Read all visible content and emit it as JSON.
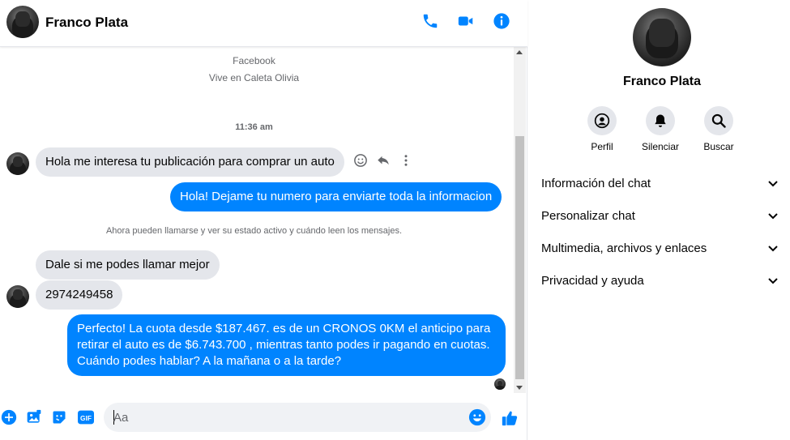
{
  "contact": {
    "name": "Franco Plata"
  },
  "chat": {
    "meta": {
      "source": "Facebook",
      "location": "Vive en Caleta Olivia"
    },
    "timestamp": "11:36 am",
    "messages": [
      {
        "direction": "in",
        "text": "Hola me interesa tu publicación para comprar un auto"
      },
      {
        "direction": "out",
        "text": "Hola! Dejame tu numero  para enviarte toda la informacion"
      },
      {
        "direction": "in",
        "text": "Dale si me podes llamar mejor"
      },
      {
        "direction": "in",
        "text": "2974249458"
      },
      {
        "direction": "out",
        "text": "Perfecto! La cuota desde $187.467. es de un CRONOS 0KM el anticipo para retirar el auto es de $6.743.700 , mientras tanto podes ir pagando en cuotas. Cuándo podes hablar? A la mañana o a la tarde?"
      }
    ],
    "notice": "Ahora pueden llamarse y ver su estado activo y cuándo leen los mensajes.",
    "composer": {
      "placeholder": "Aa",
      "gif_label": "GIF"
    }
  },
  "info": {
    "actions": [
      {
        "label": "Perfil",
        "icon": "profile-icon"
      },
      {
        "label": "Silenciar",
        "icon": "bell-icon"
      },
      {
        "label": "Buscar",
        "icon": "search-icon"
      }
    ],
    "sections": [
      {
        "label": "Información del chat"
      },
      {
        "label": "Personalizar chat"
      },
      {
        "label": "Multimedia, archivos y enlaces"
      },
      {
        "label": "Privacidad y ayuda"
      }
    ]
  },
  "colors": {
    "accent": "#0084ff",
    "incoming_bubble": "#e4e6eb",
    "muted_text": "#65676b"
  }
}
